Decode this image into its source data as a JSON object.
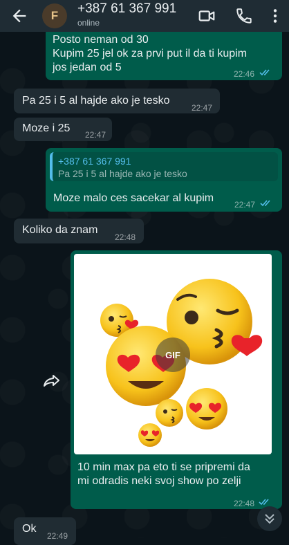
{
  "header": {
    "avatar_letter": "F",
    "contact_name": "+387 61 367 991",
    "status": "online"
  },
  "messages": [
    {
      "direction": "out",
      "lines": [
        "Posto neman od 30",
        "Kupim 25 jel ok za prvi put il da ti kupim",
        "jos jedan od 5"
      ],
      "time": "22:46",
      "read": true
    },
    {
      "direction": "in",
      "text": "Pa 25 i 5 al hajde ako je tesko",
      "time": "22:47"
    },
    {
      "direction": "in",
      "text": "Moze i 25",
      "time": "22:47"
    },
    {
      "direction": "out",
      "quote": {
        "author": "+387 61 367 991",
        "text": "Pa 25 i 5 al hajde ako je tesko"
      },
      "text": "Moze malo ces sacekar al kupim",
      "time": "22:47",
      "read": true
    },
    {
      "direction": "in",
      "text": "Koliko da znam",
      "time": "22:48"
    },
    {
      "direction": "out",
      "media": {
        "type": "gif",
        "badge": "GIF",
        "icons": [
          "wink-kiss-emoji-icon",
          "heart-eyes-emoji-icon",
          "kiss-emoji-icon"
        ]
      },
      "lines": [
        "10 min max pa eto ti se pripremi da",
        "mi odradis neki svoj show po zelji"
      ],
      "time": "22:48",
      "read": true
    },
    {
      "direction": "in",
      "text": "Ok",
      "time": "22:49"
    }
  ],
  "colors": {
    "incoming": "#202c33",
    "outgoing": "#005c4b",
    "header": "#1f2c34",
    "read_ticks": "#53bdeb"
  },
  "icons": {
    "back": "arrow-left-icon",
    "video": "video-call-icon",
    "phone": "phone-icon",
    "forward": "forward-icon",
    "scroll": "double-chevron-down-icon"
  }
}
